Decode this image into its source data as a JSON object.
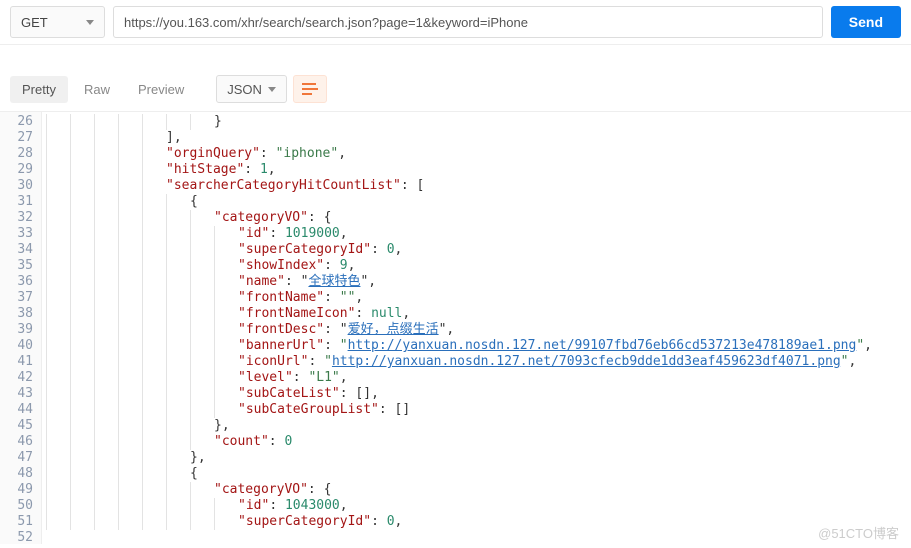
{
  "request": {
    "method": "GET",
    "url": "https://you.163.com/xhr/search/search.json?page=1&keyword=iPhone",
    "send_label": "Send"
  },
  "tabs": {
    "pretty": "Pretty",
    "raw": "Raw",
    "preview": "Preview"
  },
  "format_select": "JSON",
  "gutter": {
    "start": 26,
    "end": 52
  },
  "code": {
    "l26": {
      "ind": 7,
      "txt": "}"
    },
    "l27": {
      "ind": 5,
      "txt": "],"
    },
    "l28": {
      "ind": 5,
      "key": "orginQuery",
      "val_str": "iphone",
      "comma": ","
    },
    "l29": {
      "ind": 5,
      "key": "hitStage",
      "val_num": "1",
      "comma": ","
    },
    "l30": {
      "ind": 5,
      "key": "searcherCategoryHitCountList",
      "open": "["
    },
    "l31": {
      "ind": 6,
      "txt": "{"
    },
    "l32": {
      "ind": 7,
      "key": "categoryVO",
      "open": "{"
    },
    "l33": {
      "ind": 8,
      "key": "id",
      "val_num": "1019000",
      "comma": ","
    },
    "l34": {
      "ind": 8,
      "key": "superCategoryId",
      "val_num": "0",
      "comma": ","
    },
    "l35": {
      "ind": 8,
      "key": "showIndex",
      "val_num": "9",
      "comma": ","
    },
    "l36": {
      "ind": 8,
      "key": "name",
      "val_link": "全球特色",
      "comma": ","
    },
    "l37": {
      "ind": 8,
      "key": "frontName",
      "val_str": "",
      "comma": ","
    },
    "l38": {
      "ind": 8,
      "key": "frontNameIcon",
      "val_null": "null",
      "comma": ","
    },
    "l39": {
      "ind": 8,
      "key": "frontDesc",
      "val_link": "爱好，点缀生活",
      "comma": ","
    },
    "l40": {
      "ind": 8,
      "key": "bannerUrl",
      "val_linkq": "http://yanxuan.nosdn.127.net/99107fbd76eb66cd537213e478189ae1.png",
      "comma": ","
    },
    "l41": {
      "ind": 8,
      "key": "iconUrl",
      "val_linkq": "http://yanxuan.nosdn.127.net/7093cfecb9dde1dd3eaf459623df4071.png",
      "comma": ","
    },
    "l42": {
      "ind": 8,
      "key": "level",
      "val_str": "L1",
      "comma": ","
    },
    "l43": {
      "ind": 8,
      "key": "subCateList",
      "open": "[]",
      "comma": ","
    },
    "l44": {
      "ind": 8,
      "key": "subCateGroupList",
      "open": "[]"
    },
    "l45": {
      "ind": 7,
      "txt": "},"
    },
    "l46": {
      "ind": 7,
      "key": "count",
      "val_num": "0"
    },
    "l47": {
      "ind": 6,
      "txt": "},"
    },
    "l48": {
      "ind": 6,
      "txt": "{"
    },
    "l49": {
      "ind": 7,
      "key": "categoryVO",
      "open": "{"
    },
    "l50": {
      "ind": 8,
      "key": "id",
      "val_num": "1043000",
      "comma": ","
    },
    "l51": {
      "ind": 8,
      "key": "superCategoryId",
      "val_num": "0",
      "comma": ","
    }
  },
  "watermark": "@51CTO博客"
}
